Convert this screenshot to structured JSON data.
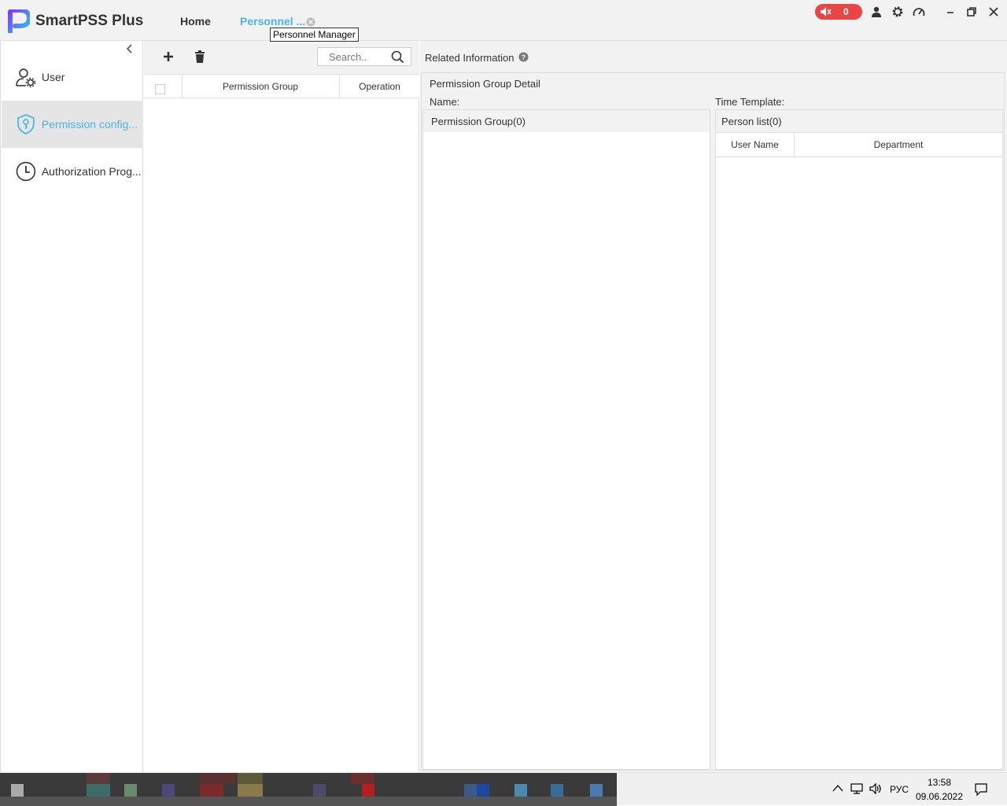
{
  "app": {
    "title": "SmartPSS Plus",
    "brand_color": "#4db3ea",
    "alarm_count": "0"
  },
  "tabs": [
    {
      "label": "Home",
      "active": false
    },
    {
      "label": "Personnel ...",
      "active": true,
      "tooltip": "Personnel Manager"
    }
  ],
  "sidebar": {
    "items": [
      {
        "label": "User",
        "icon": "user-gear-icon",
        "selected": false
      },
      {
        "label": "Permission config...",
        "icon": "shield-key-icon",
        "selected": true
      },
      {
        "label": "Authorization Prog...",
        "icon": "clock-icon",
        "selected": false
      }
    ]
  },
  "list": {
    "search_placeholder": "Search..",
    "columns": [
      "Permission Group",
      "Operation"
    ],
    "rows": []
  },
  "related": {
    "title": "Related Information",
    "detail_title": "Permission Group Detail",
    "name_label": "Name:",
    "time_template_label": "Time Template:",
    "permission_group_title": "Permission Group(0)",
    "person_list_title": "Person list(0)",
    "person_columns": [
      "User Name",
      "Department"
    ]
  },
  "taskbar": {
    "lang": "РУС",
    "time": "13:58",
    "date": "09.06.2022"
  }
}
